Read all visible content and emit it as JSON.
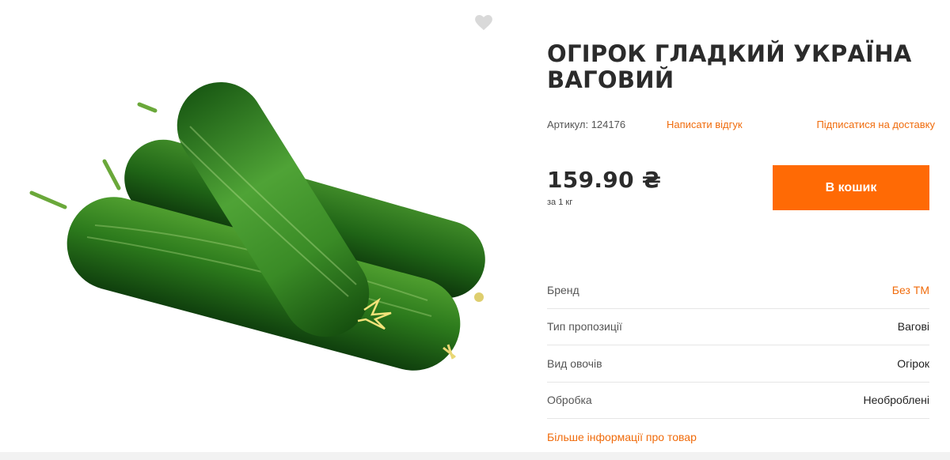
{
  "product": {
    "title": "ОГІРОК ГЛАДКИЙ УКРАЇНА ВАГОВИЙ",
    "sku_label": "Артикул: 124176",
    "review_link": "Написати відгук",
    "subscribe_link": "Підписатися на доставку",
    "price": "159.90 ₴",
    "price_unit": "за 1 кг",
    "cart_button": "В кошик",
    "image_icon": "cucumber-product-image",
    "wishlist_icon": "heart-icon"
  },
  "specs": [
    {
      "label": "Бренд",
      "value": "Без ТМ"
    },
    {
      "label": "Тип пропозиції",
      "value": "Вагові"
    },
    {
      "label": "Вид овочів",
      "value": "Огірок"
    },
    {
      "label": "Обробка",
      "value": "Необроблені"
    }
  ],
  "more_info_link": "Більше інформації про товар",
  "colors": {
    "accent": "#ff6a05",
    "link": "#f06b0b",
    "title": "#2b2b2b",
    "divider": "#e6e6e6",
    "wishlist": "#d9d9d9"
  }
}
